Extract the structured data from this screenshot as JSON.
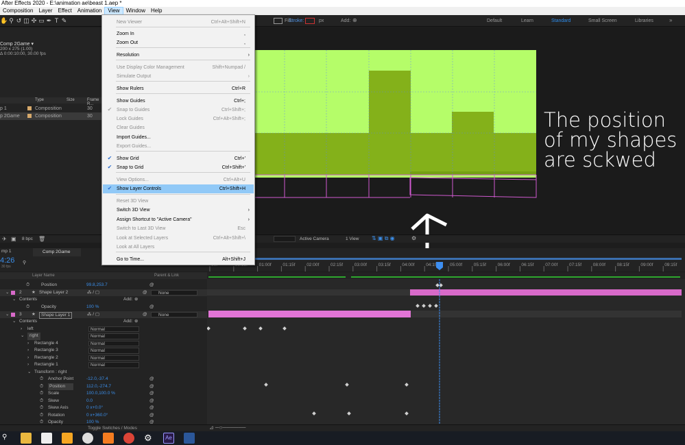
{
  "window": {
    "title": "After Effects 2020 - E:\\animation ae\\beast 1.aep *"
  },
  "menubar": [
    "Composition",
    "Layer",
    "Effect",
    "Animation",
    "View",
    "Window",
    "Help"
  ],
  "toolbar": {
    "fill_label": "Fill:",
    "stroke_label": "Stroke:",
    "stroke_unit": "px",
    "add_label": "Add:",
    "workspaces": [
      "Default",
      "Learn",
      "Standard",
      "Small Screen",
      "Libraries"
    ],
    "active_workspace": "Standard"
  },
  "project": {
    "comp_name": "Comp 2Game ▾",
    "comp_size": "200 x 275 (1.00)",
    "comp_duration": "Δ 0:00:10:00, 30.00 fps",
    "columns": [
      "Type",
      "Size",
      "Frame R..."
    ],
    "rows": [
      {
        "name": "p 1",
        "type": "Composition",
        "fps": "30"
      },
      {
        "name": "p 2Game",
        "type": "Composition",
        "fps": "30"
      }
    ],
    "bpc": "8 bpc"
  },
  "view_menu": {
    "items": [
      {
        "label": "New Viewer",
        "shortcut": "Ctrl+Alt+Shift+N",
        "disabled": true
      },
      {
        "label": "Zoom In",
        "shortcut": ","
      },
      {
        "label": "Zoom Out",
        "shortcut": ","
      },
      {
        "label": "Resolution",
        "submenu": true
      },
      {
        "label": "Use Display Color Management",
        "shortcut": "Shift+Numpad /",
        "disabled": true
      },
      {
        "label": "Simulate Output",
        "submenu": true,
        "disabled": true
      },
      {
        "label": "Show Rulers",
        "shortcut": "Ctrl+R"
      },
      {
        "label": "Show Guides",
        "shortcut": "Ctrl+;"
      },
      {
        "label": "Snap to Guides",
        "shortcut": "Ctrl+Shift+;",
        "disabled": true,
        "checked": true
      },
      {
        "label": "Lock Guides",
        "shortcut": "Ctrl+Alt+Shift+;",
        "disabled": true
      },
      {
        "label": "Clear Guides",
        "disabled": true
      },
      {
        "label": "Import Guides..."
      },
      {
        "label": "Export Guides...",
        "disabled": true
      },
      {
        "label": "Show Grid",
        "shortcut": "Ctrl+'",
        "checked": true
      },
      {
        "label": "Snap to Grid",
        "shortcut": "Ctrl+Shift+'",
        "checked": true
      },
      {
        "label": "View Options...",
        "shortcut": "Ctrl+Alt+U",
        "disabled": true
      },
      {
        "label": "Show Layer Controls",
        "shortcut": "Ctrl+Shift+H",
        "checked": true,
        "highlighted": true
      },
      {
        "label": "Reset 3D View",
        "disabled": true
      },
      {
        "label": "Switch 3D View",
        "submenu": true
      },
      {
        "label": "Assign Shortcut to \"Active Camera\"",
        "submenu": true
      },
      {
        "label": "Switch to Last 3D View",
        "shortcut": "Esc",
        "disabled": true
      },
      {
        "label": "Look at Selected Layers",
        "shortcut": "Ctrl+Alt+Shift+\\",
        "disabled": true
      },
      {
        "label": "Look at All Layers",
        "disabled": true
      },
      {
        "label": "Go to Time...",
        "shortcut": "Alt+Shift+J"
      }
    ]
  },
  "viewer": {
    "camera": "Active Camera",
    "views": "1 View",
    "annotation": "The position of my shapes are sckwed"
  },
  "timeline": {
    "tabs": [
      "mp 1",
      "Comp 2Game"
    ],
    "current_time": "4:26",
    "fps_hint": "30 fps",
    "ruler": [
      "00f",
      "00:15f",
      "01:00f",
      "01:15f",
      "02:00f",
      "02:15f",
      "03:00f",
      "03:15f",
      "04:00f",
      "04:15f",
      "05:00f",
      "05:15f",
      "06:00f",
      "06:15f",
      "07:00f",
      "07:15f",
      "08:00f",
      "08:15f",
      "09:00f",
      "09:15f"
    ],
    "columns": {
      "layer_name": "Layer Name",
      "parent": "Parent & Link"
    },
    "add_label": "Add:",
    "layers": [
      {
        "kind": "prop",
        "label": "Position",
        "value": "99.8,253.7"
      },
      {
        "kind": "layer",
        "index": "2",
        "name": "Shape Layer 2",
        "parent": "None"
      },
      {
        "kind": "group",
        "label": "Contents"
      },
      {
        "kind": "prop",
        "label": "Opacity",
        "value": "100 %"
      },
      {
        "kind": "layer",
        "index": "3",
        "name": "Shape Layer 1",
        "parent": "None"
      },
      {
        "kind": "group",
        "label": "Contents"
      },
      {
        "kind": "shape",
        "label": "left",
        "mode": "Normal"
      },
      {
        "kind": "shape",
        "label": "right",
        "mode": "Normal"
      },
      {
        "kind": "shape",
        "label": "Rectangle 4",
        "mode": "Normal"
      },
      {
        "kind": "shape",
        "label": "Rectangle 3",
        "mode": "Normal"
      },
      {
        "kind": "shape",
        "label": "Rectangle 2",
        "mode": "Normal"
      },
      {
        "kind": "shape",
        "label": "Rectangle 1",
        "mode": "Normal"
      },
      {
        "kind": "group",
        "label": "Transform : right"
      },
      {
        "kind": "prop",
        "label": "Anchor Point",
        "value": "-12.0,-37.4"
      },
      {
        "kind": "prop",
        "label": "Position",
        "value": "112.0,-274.7"
      },
      {
        "kind": "prop",
        "label": "Scale",
        "value": "100.0,100.0 %"
      },
      {
        "kind": "prop",
        "label": "Skew",
        "value": "0.0"
      },
      {
        "kind": "prop",
        "label": "Skew Axis",
        "value": "0 x+0.0°"
      },
      {
        "kind": "prop",
        "label": "Rotation",
        "value": "0 x+360.0°"
      },
      {
        "kind": "prop",
        "label": "Opacity",
        "value": "100 %"
      }
    ],
    "footer": "Toggle Switches / Modes"
  },
  "colors": {
    "accent": "#2d8ceb",
    "canvas": "#b5fd69",
    "shape": "#84b11a",
    "layer_pink": "#d86ac9",
    "playhead": "#3d8ef0"
  }
}
